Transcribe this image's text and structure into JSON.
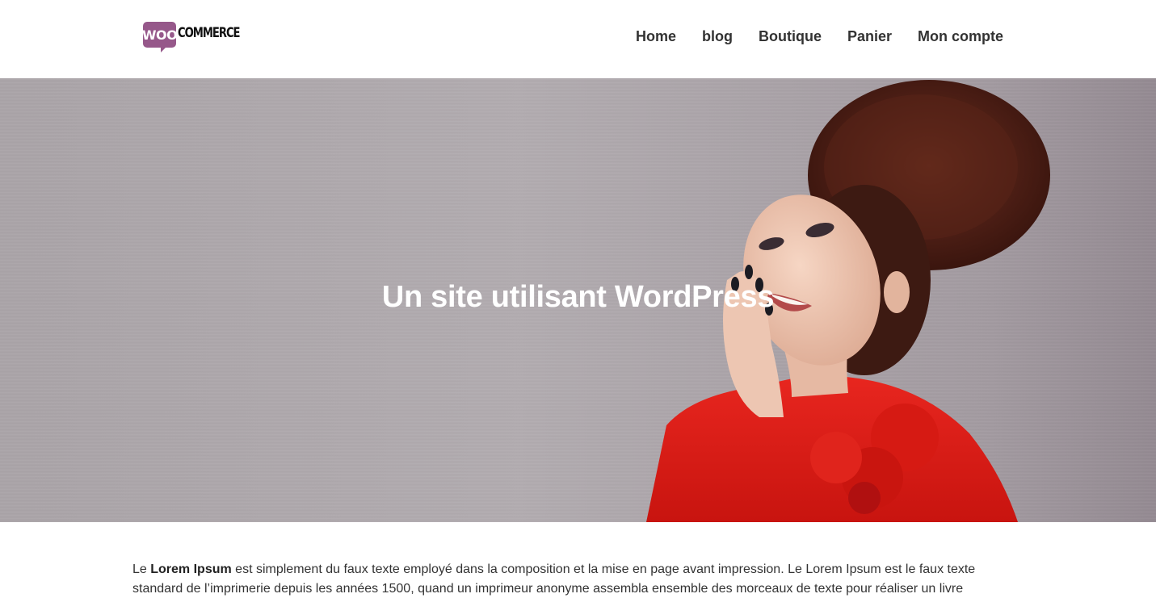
{
  "logo": {
    "woo": "WOO",
    "commerce": "COMMERCE",
    "brand_color": "#96588a"
  },
  "nav": {
    "items": [
      {
        "label": "Home"
      },
      {
        "label": "blog"
      },
      {
        "label": "Boutique"
      },
      {
        "label": "Panier"
      },
      {
        "label": "Mon compte"
      }
    ]
  },
  "hero": {
    "title": "Un site utilisant WordPress",
    "image": "woman-laughing-red-dress-photo"
  },
  "content": {
    "lead_prefix": "Le ",
    "lead_bold": "Lorem Ipsum",
    "lead_rest": " est simplement du faux texte employé dans la composition et la mise en page avant impression. Le Lorem Ipsum est le faux texte standard de l’imprimerie depuis les années 1500, quand un imprimeur anonyme assembla ensemble des morceaux de texte pour réaliser un livre"
  }
}
